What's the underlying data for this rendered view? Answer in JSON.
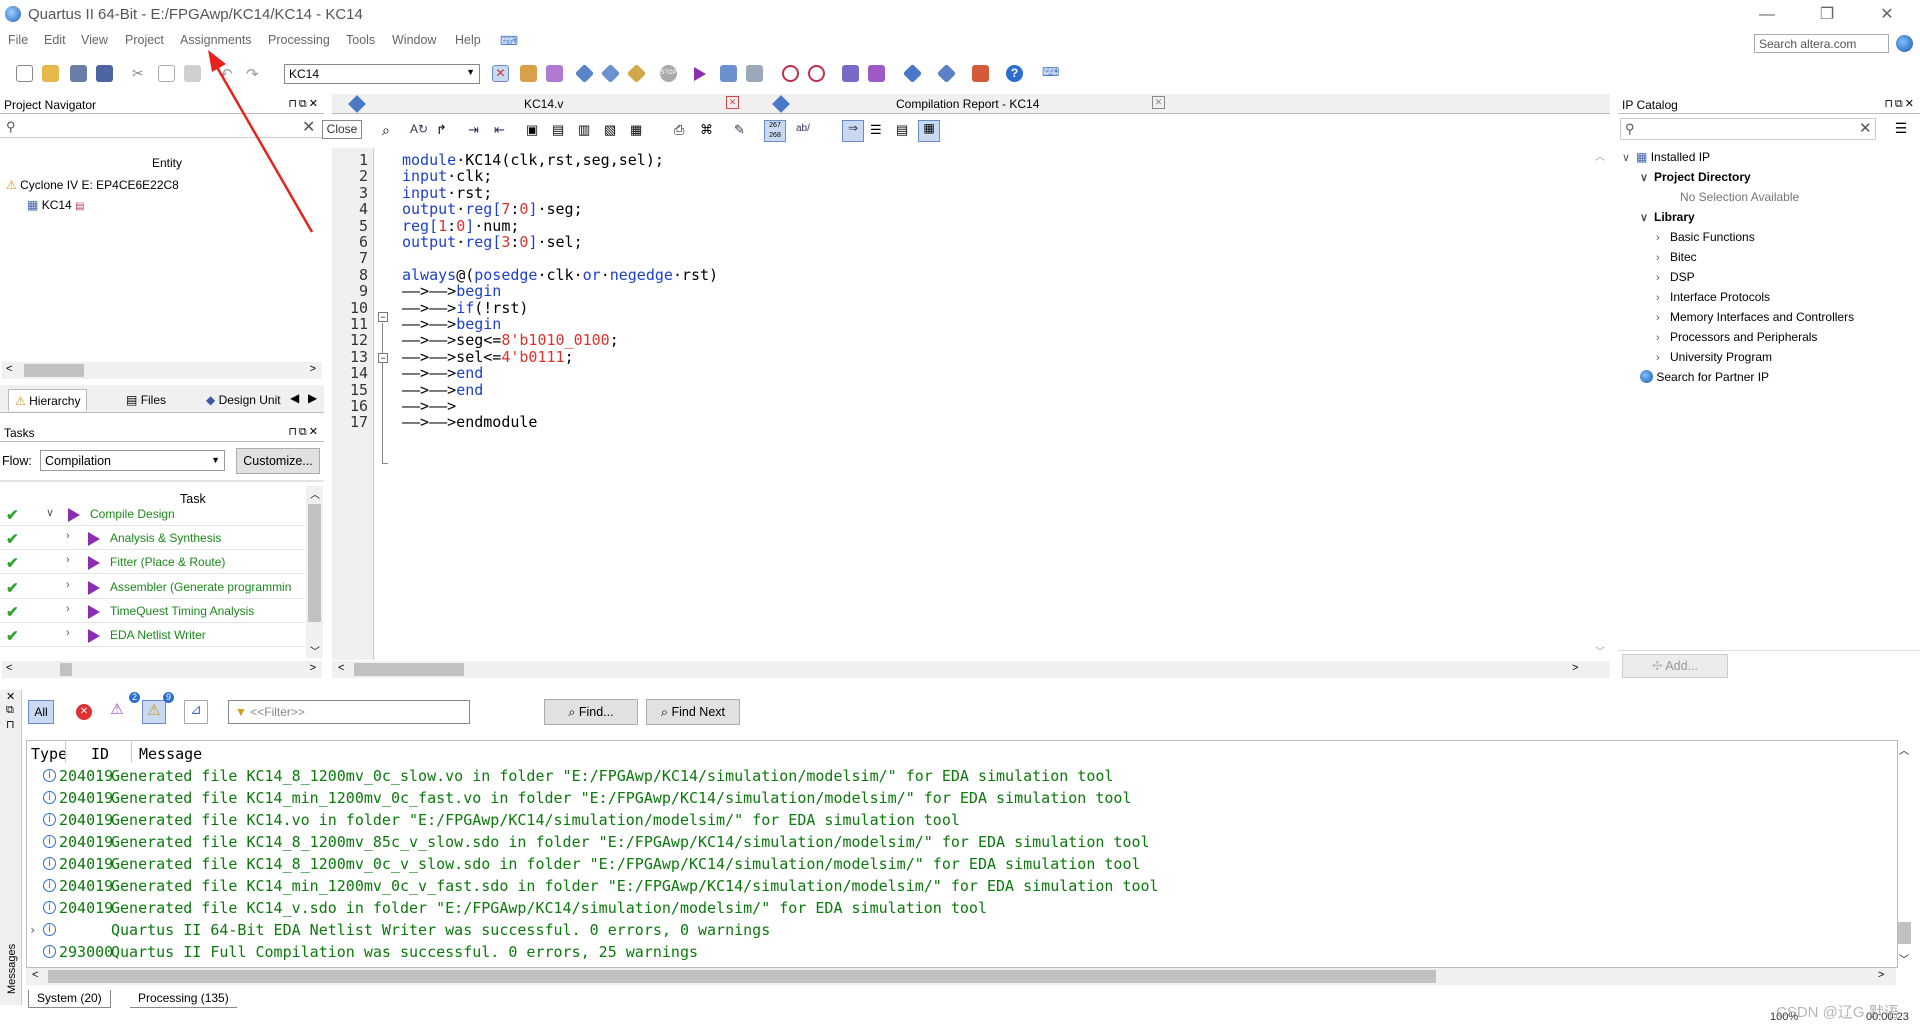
{
  "window": {
    "title": "Quartus II 64-Bit - E:/FPGAwp/KC14/KC14 - KC14",
    "min": "—",
    "max": "❐",
    "close": "✕"
  },
  "menu": [
    "File",
    "Edit",
    "View",
    "Project",
    "Assignments",
    "Processing",
    "Tools",
    "Window",
    "Help"
  ],
  "search": {
    "placeholder": "Search altera.com"
  },
  "toolbar": {
    "entity_combo": "KC14"
  },
  "project_navigator": {
    "title": "Project Navigator",
    "column": "Entity",
    "device": "Cyclone IV E: EP4CE6E22C8",
    "top_entity": "KC14",
    "tabs": [
      "Hierarchy",
      "Files",
      "Design Unit"
    ],
    "close_tooltip": "Close"
  },
  "tasks": {
    "title": "Tasks",
    "flow_label": "Flow:",
    "flow_value": "Compilation",
    "customize": "Customize...",
    "column": "Task",
    "rows": [
      {
        "label": "Compile Design",
        "indent": 0,
        "status": "done"
      },
      {
        "label": "Analysis & Synthesis",
        "indent": 1,
        "status": "done"
      },
      {
        "label": "Fitter (Place & Route)",
        "indent": 1,
        "status": "done"
      },
      {
        "label": "Assembler (Generate programmin",
        "indent": 1,
        "status": "done"
      },
      {
        "label": "TimeQuest Timing Analysis",
        "indent": 1,
        "status": "done"
      },
      {
        "label": "EDA Netlist Writer",
        "indent": 1,
        "status": "done"
      }
    ]
  },
  "editor": {
    "tabs": [
      {
        "label": "KC14.v"
      },
      {
        "label": "Compilation Report - KC14"
      }
    ],
    "lines": [
      {
        "n": "1",
        "t": "module·KC14(clk,rst,seg,sel);"
      },
      {
        "n": "2",
        "t": "input·clk;"
      },
      {
        "n": "3",
        "t": "input·rst;"
      },
      {
        "n": "4",
        "t": "output·reg[7:0]·seg;"
      },
      {
        "n": "5",
        "t": "reg[1:0]·num;"
      },
      {
        "n": "6",
        "t": "output·reg[3:0]·sel;"
      },
      {
        "n": "7",
        "t": ""
      },
      {
        "n": "8",
        "t": "always@(posedge·clk·or·negedge·rst)"
      },
      {
        "n": "9",
        "t": "——>——>begin"
      },
      {
        "n": "10",
        "t": "——>——>if(!rst)"
      },
      {
        "n": "11",
        "t": "——>——>begin"
      },
      {
        "n": "12",
        "t": "——>——>seg<=8'b1010_0100;"
      },
      {
        "n": "13",
        "t": "——>——>sel<=4'b0111;"
      },
      {
        "n": "14",
        "t": "——>——>end"
      },
      {
        "n": "15",
        "t": "——>——>end"
      },
      {
        "n": "16",
        "t": "——>——>"
      },
      {
        "n": "17",
        "t": "——>——>endmodule"
      }
    ]
  },
  "ip_catalog": {
    "title": "IP Catalog",
    "installed": "Installed IP",
    "project_dir": "Project Directory",
    "no_selection": "No Selection Available",
    "library": "Library",
    "items": [
      "Basic Functions",
      "Bitec",
      "DSP",
      "Interface Protocols",
      "Memory Interfaces and Controllers",
      "Processors and Peripherals",
      "University Program"
    ],
    "partner": "Search for Partner IP",
    "add": "Add..."
  },
  "messages": {
    "filter_all": "All",
    "badge_error_count": "2",
    "badge_warning_count": "9",
    "filter_placeholder": "<<Filter>>",
    "find": "Find...",
    "find_next": "Find Next",
    "col_type": "Type",
    "col_id": "ID",
    "col_msg": "Message",
    "side_label": "Messages",
    "rows": [
      {
        "id": "204019",
        "msg": "Generated file KC14_8_1200mv_0c_slow.vo in folder \"E:/FPGAwp/KC14/simulation/modelsim/\" for EDA simulation tool"
      },
      {
        "id": "204019",
        "msg": "Generated file KC14_min_1200mv_0c_fast.vo in folder \"E:/FPGAwp/KC14/simulation/modelsim/\" for EDA simulation tool"
      },
      {
        "id": "204019",
        "msg": "Generated file KC14.vo in folder \"E:/FPGAwp/KC14/simulation/modelsim/\" for EDA simulation tool"
      },
      {
        "id": "204019",
        "msg": "Generated file KC14_8_1200mv_85c_v_slow.sdo in folder \"E:/FPGAwp/KC14/simulation/modelsim/\" for EDA simulation tool"
      },
      {
        "id": "204019",
        "msg": "Generated file KC14_8_1200mv_0c_v_slow.sdo in folder \"E:/FPGAwp/KC14/simulation/modelsim/\" for EDA simulation tool"
      },
      {
        "id": "204019",
        "msg": "Generated file KC14_min_1200mv_0c_v_fast.sdo in folder \"E:/FPGAwp/KC14/simulation/modelsim/\" for EDA simulation tool"
      },
      {
        "id": "204019",
        "msg": "Generated file KC14_v.sdo in folder \"E:/FPGAwp/KC14/simulation/modelsim/\" for EDA simulation tool"
      },
      {
        "id": "",
        "msg": "Quartus II 64-Bit EDA Netlist Writer was successful. 0 errors, 0 warnings"
      },
      {
        "id": "293000",
        "msg": "Quartus II Full Compilation was successful. 0 errors, 25 warnings"
      }
    ],
    "bottom_tabs": [
      "System (20)",
      "Processing (135)"
    ]
  },
  "status": {
    "zoom": "100%",
    "time": "00:00:23",
    "watermark": "CSDN @辽G.默语"
  },
  "colors": {
    "keyword": "#1c3fd1",
    "literal": "#e0302a",
    "message_green": "#0a7a0a",
    "task_green": "#1a8a1a",
    "annotation_arrow": "#e8221d"
  }
}
